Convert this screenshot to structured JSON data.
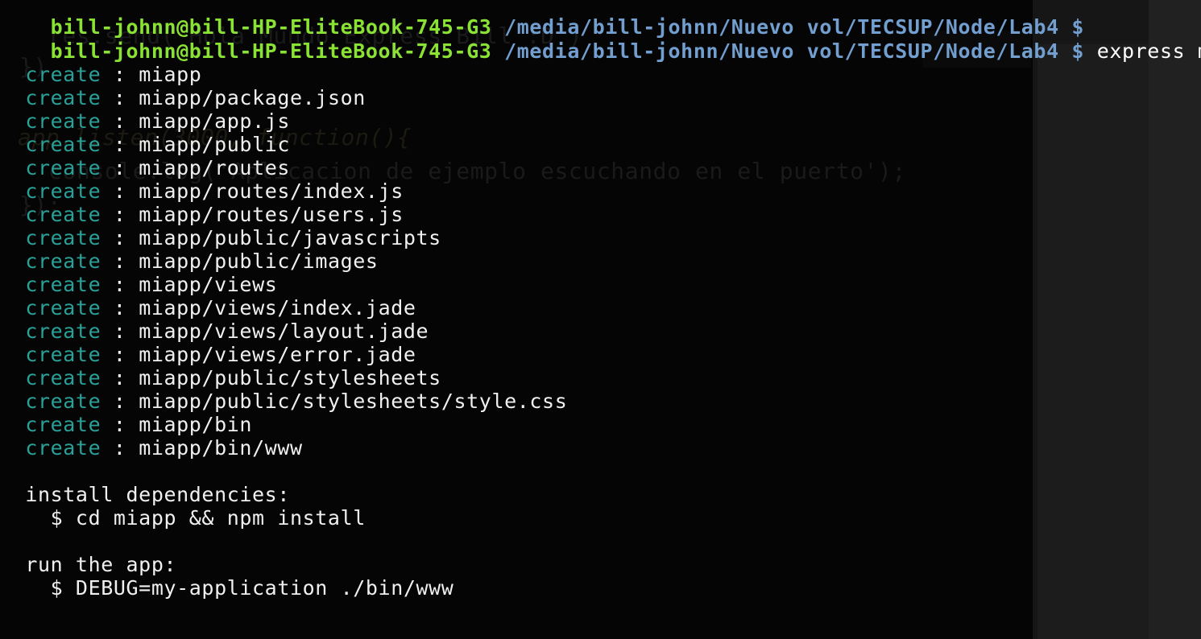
{
  "prompt": {
    "user_host": "bill-johnn@bill-HP-EliteBook-745-G3",
    "path": "/media/bill-johnn/Nuevo vol/TECSUP/Node/Lab4",
    "symbol": "$"
  },
  "command": "express miapp",
  "create_verb": "create",
  "separator": ":",
  "created_files": [
    "miapp",
    "miapp/package.json",
    "miapp/app.js",
    "miapp/public",
    "miapp/routes",
    "miapp/routes/index.js",
    "miapp/routes/users.js",
    "miapp/public/javascripts",
    "miapp/public/images",
    "miapp/views",
    "miapp/views/index.jade",
    "miapp/views/layout.jade",
    "miapp/views/error.jade",
    "miapp/public/stylesheets",
    "miapp/public/stylesheets/style.css",
    "miapp/bin",
    "miapp/bin/www"
  ],
  "install": {
    "heading": "install dependencies:",
    "command": "$ cd miapp && npm install"
  },
  "run": {
    "heading": "run the app:",
    "command": "$ DEBUG=my-application ./bin/www"
  },
  "background_editor": {
    "lines": [
      "res.send('Hola Mundo Express Bill :D')",
      "})",
      "app.listen(3000, function(){",
      "console.log('Aplicacion de ejemplo escuchando en el puerto');",
      "});"
    ]
  },
  "colors": {
    "user_host": "#8ae234",
    "path": "#729fcf",
    "create_verb": "#2aa198",
    "text": "#f0f0f0",
    "background": "#050505"
  }
}
